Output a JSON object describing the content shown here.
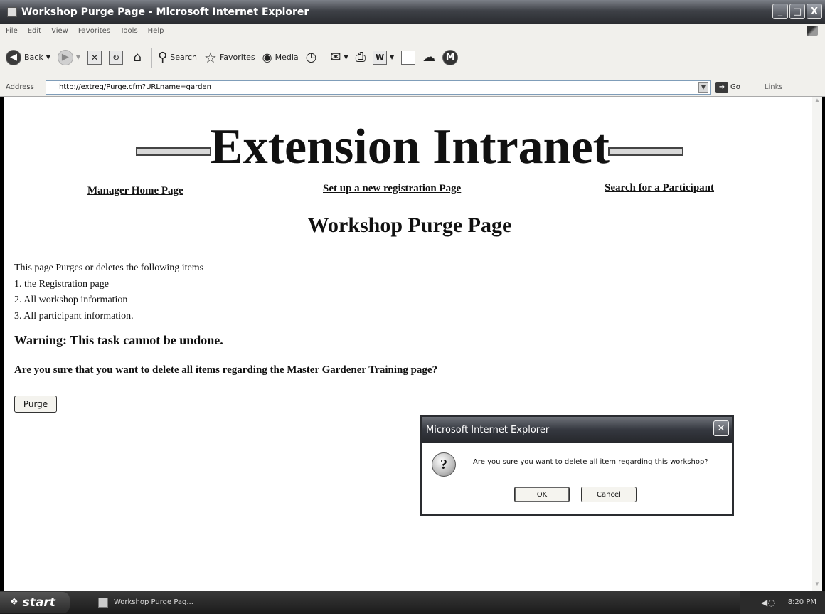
{
  "window": {
    "title": "Workshop Purge Page - Microsoft Internet Explorer",
    "controls": {
      "minimize": "_",
      "maximize": "□",
      "close": "X"
    }
  },
  "menu": [
    "File",
    "Edit",
    "View",
    "Favorites",
    "Tools",
    "Help"
  ],
  "toolbar": {
    "back_label": "Back",
    "search_label": "Search",
    "favorites_label": "Favorites",
    "media_label": "Media"
  },
  "address": {
    "label": "Address",
    "url": "http://extreg/Purge.cfm?URLname=garden",
    "go_label": "Go",
    "links_label": "Links"
  },
  "page": {
    "banner_title": "Extension Intranet",
    "nav": {
      "manager_home": "Manager Home Page",
      "new_registration": "Set up a new registration Page",
      "search_participant": "Search for a Participant"
    },
    "heading": "Workshop Purge Page",
    "intro_lines": [
      "This page Purges or deletes the following items",
      "1. the Registration page",
      "2. All workshop information",
      "3. All participant information."
    ],
    "warning": "Warning: This task cannot be undone.",
    "question": "Are you sure that you want to delete all items regarding the Master Gardener Training page?",
    "purge_button": "Purge"
  },
  "dialog": {
    "title": "Microsoft Internet Explorer",
    "icon": "?",
    "message": "Are you sure you want to delete all item regarding this workshop?",
    "ok_label": "OK",
    "cancel_label": "Cancel"
  },
  "taskbar": {
    "start_label": "start",
    "task_item": "Workshop Purge Pag...",
    "clock": "8:20 PM"
  }
}
